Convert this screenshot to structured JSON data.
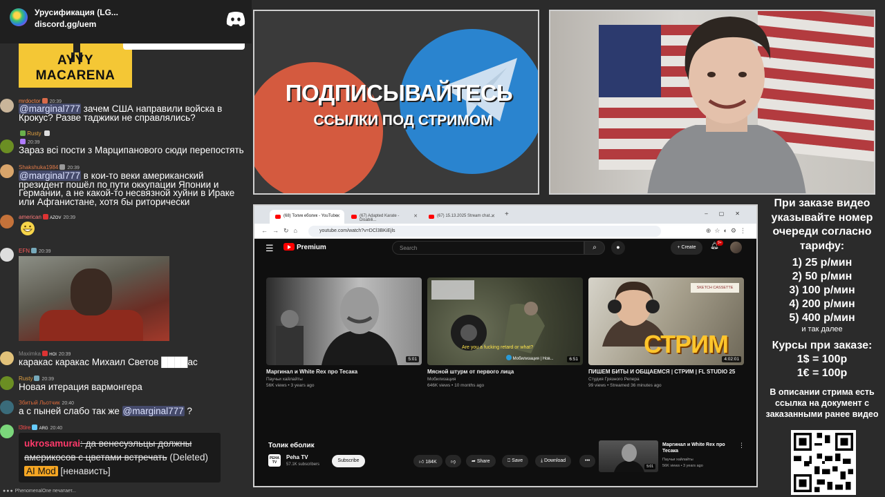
{
  "discord": {
    "title": "Урусификация (LG...",
    "link": "discord.gg/uem"
  },
  "chat": {
    "gif_text": "AYYY MACARENA",
    "messages": [
      {
        "user": "mrdoctor",
        "user_color": "#ff8a50",
        "time": "20:39",
        "mention": "@marginal777",
        "text": " зачем США направили войска в Крокус? Разве таджики не справлялись?"
      },
      {
        "user": "Rusty",
        "user_color": "#e0a040",
        "time": "",
        "text": ""
      },
      {
        "user": "",
        "user_color": "#b07cff",
        "time": "20:39",
        "text": "Зараз всі пости з Марципанового сюди перепостять"
      },
      {
        "user": "Shakshuka1984",
        "user_color": "#e07b4a",
        "time": "20:39",
        "mention": "@marginal777",
        "text": " в кои-то веки американский президент пошёл по пути оккупации Японии и Германии, а не какой-то несвязной хуйни в Ираке или Афганистане, хотя бы риторически"
      },
      {
        "user": "american",
        "user_color": "#ff7a7a",
        "time": "20:39",
        "badge_text": "AZOV",
        "text": ""
      },
      {
        "user": "EFN",
        "user_color": "#ff5c5c",
        "time": "20:39",
        "text": ""
      },
      {
        "user": "Maximka",
        "user_color": "#888888",
        "time": "20:39",
        "badge_text": "HOI",
        "text": "каракас каракас Михаил Светов ████ас"
      },
      {
        "user": "Rusty",
        "user_color": "#e0a040",
        "time": "20:39",
        "text": "Новая итерация вармонгера"
      },
      {
        "user": "Збитый Льотчик",
        "user_color": "#e06a3a",
        "time": "20:40",
        "text": "а с пыней слабо так же ",
        "mention_end": "@marginal777",
        "tail": " ?"
      },
      {
        "user": "l3tire",
        "user_color": "#ff4d4d",
        "time": "20:40",
        "badge_text": "ARG",
        "text": ""
      }
    ],
    "highlight": {
      "user": "ukrosamurai",
      "deleted_text": "да венесуэльцы должны америкосов с цветами встречать",
      "status": "(Deleted)",
      "mod_label": "AI Mod",
      "reason": "[ненависть]"
    },
    "typing": "PhenomenalOne печатает..."
  },
  "promo": {
    "headline": "ПОДПИСЫВАЙТЕСЬ",
    "sub": "ССЫЛКИ ПОД СТРИМОМ"
  },
  "browser": {
    "tabs": [
      {
        "label": "(68) Толик еболик - YouTube"
      },
      {
        "label": "(67) Adapted Karate - Disabili..."
      },
      {
        "label": "(67) 15.13.2025 Stream chat..."
      }
    ],
    "url": "youtube.com/watch?v=DCl3BKiEjls"
  },
  "youtube": {
    "brand": "Premium",
    "search_placeholder": "Search",
    "create_label": "Create",
    "notif_count": "9+",
    "videos": [
      {
        "title": "Маргинал и White Rex про Тесака",
        "channel": "Паучьи хайлайты",
        "meta": "56K views • 3 years ago",
        "duration": "5:01"
      },
      {
        "title": "Мясной штурм от первого лица",
        "channel": "Мобилизация",
        "meta": "646K views • 10 months ago",
        "duration": "6:51",
        "caption": "Are you a fucking retard or what?",
        "watermark": "Мобилизация | Нов..."
      },
      {
        "title": "ПИШЕМ БИТЫ И ОБЩАЕМСЯ | СТРИМ | FL STUDIO 25",
        "channel": "Студия Грязного Репера",
        "meta": "99 views • Streamed 36 minutes ago",
        "duration": "4:02:01",
        "overlay": "СТРИМ",
        "sign": "SKETCH CASSETTE"
      }
    ],
    "watch": {
      "title": "Толик еболик",
      "channel_initials": "PEHA TV",
      "channel": "Peha TV",
      "subs": "57.1K subscribers",
      "subscribe": "Subscribe",
      "likes": "184K",
      "share": "Share",
      "save": "Save",
      "download": "Download"
    },
    "sidebar_video": {
      "title": "Маргинал и White Rex про Тесака",
      "channel": "Паучьи хайлайты",
      "meta": "56K views • 3 years ago",
      "duration": "5:01"
    }
  },
  "info": {
    "order_text": "При заказе видео указывайте номер очереди согласно тарифу:",
    "tariffs": [
      "1) 25 р/мин",
      "2) 50 р/мин",
      "3) 100 р/мин",
      "4) 200 р/мин",
      "5) 400 р/мин"
    ],
    "etc": "и так далее",
    "rates_title": "Курсы при заказе:",
    "rates": [
      "1$ = 100р",
      "1€ = 100р"
    ],
    "description": "В описании стрима есть ссылка на документ с заказанными ранее видео"
  },
  "colors": {
    "youtube_red": "#ff0000",
    "discord_blurple": "#ffffff",
    "mention_bg": "#454a6b",
    "ai_mod": "#f5a623"
  }
}
